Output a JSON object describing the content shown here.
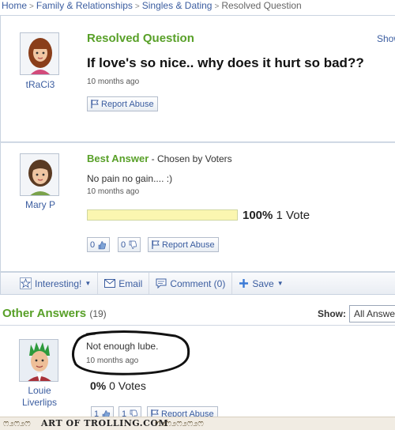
{
  "breadcrumb": {
    "items": [
      "Home",
      "Family & Relationships",
      "Singles & Dating"
    ],
    "current": "Resolved Question"
  },
  "question": {
    "label": "Resolved Question",
    "show_link": "Show",
    "title": "If love's so nice.. why does it hurt so bad??",
    "asker": "tRaCi3",
    "time": "10 months ago",
    "report_label": "Report Abuse"
  },
  "best_answer": {
    "label": "Best Answer",
    "chosen_by": "- Chosen by Voters",
    "text": "No pain no gain.... :)",
    "time": "10 months ago",
    "answerer": "Mary P",
    "percent": "100%",
    "votes": "1 Vote",
    "vote_fraction": 1.0,
    "thumbs_up": "0",
    "thumbs_down": "0",
    "report_label": "Report Abuse"
  },
  "toolbar": {
    "interesting": "Interesting!",
    "email": "Email",
    "comment": "Comment (0)",
    "save": "Save"
  },
  "other_answers": {
    "label": "Other Answers",
    "count": "(19)",
    "show_label": "Show:",
    "show_value": "All Answers",
    "answers": [
      {
        "user_line1": "Louie",
        "user_line2": "Liverlips",
        "text": "Not enough lube.",
        "time": "10 months ago",
        "percent": "0%",
        "votes": "0 Votes",
        "thumbs_up": "1",
        "thumbs_down": "1",
        "report_label": "Report Abuse"
      }
    ]
  },
  "footer": {
    "text": "ART OF TROLLING.COM"
  },
  "colors": {
    "accent_green": "#58a028",
    "link_blue": "#3b5da0",
    "vote_bar": "#fbf6b0"
  }
}
